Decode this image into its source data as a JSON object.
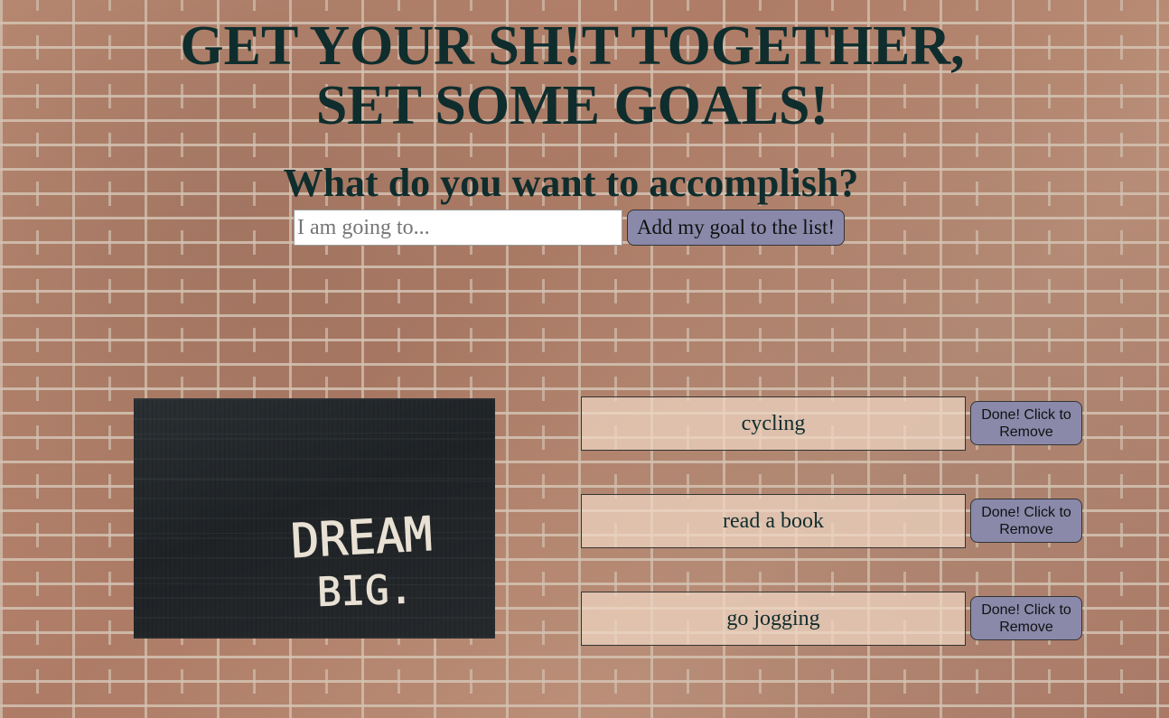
{
  "header": {
    "title_line1": "GET YOUR SH!T TOGETHER,",
    "title_line2": "SET SOME GOALS!",
    "question": "What do you want to accomplish?"
  },
  "form": {
    "input_value": "",
    "input_placeholder": "I am going to...",
    "add_button_label": "Add my goal to the list!"
  },
  "image": {
    "text_line1": "DREAM",
    "text_line2": "BIG."
  },
  "goals": [
    {
      "text": "cycling",
      "remove_label": "Done! Click to Remove"
    },
    {
      "text": "read a book",
      "remove_label": "Done! Click to Remove"
    },
    {
      "text": "go jogging",
      "remove_label": "Done! Click to Remove"
    }
  ],
  "colors": {
    "heading": "#0f2d2d",
    "button_bg": "#8a89aa",
    "goal_bg": "#f0d7c3",
    "brick": "#b07a62"
  }
}
